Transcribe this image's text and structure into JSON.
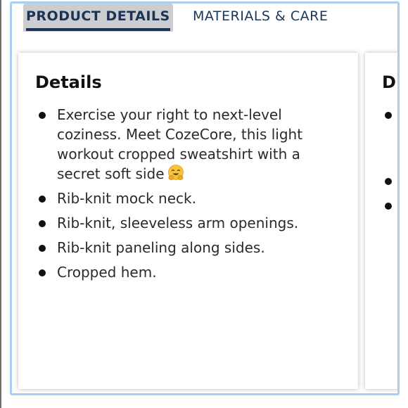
{
  "tabs": [
    {
      "label": "PRODUCT DETAILS",
      "active": true
    },
    {
      "label": "MATERIALS & CARE",
      "active": false
    }
  ],
  "details_panel": {
    "title": "Details",
    "bullets": [
      "Exercise your right to next-level coziness. Meet CozeCore, this light workout cropped sweatshirt with a secret soft side",
      "Rib-knit mock neck.",
      "Rib-knit, sleeveless arm openings.",
      "Rib-knit paneling along sides.",
      "Cropped hem."
    ],
    "first_bullet_emoji": "hugging-face-emoji"
  },
  "next_panel": {
    "title_visible_fragment": "D"
  },
  "colors": {
    "tab_text": "#1b3355",
    "tab_active_bg": "#cbcdd0",
    "frame_border": "#a9cdf3"
  }
}
